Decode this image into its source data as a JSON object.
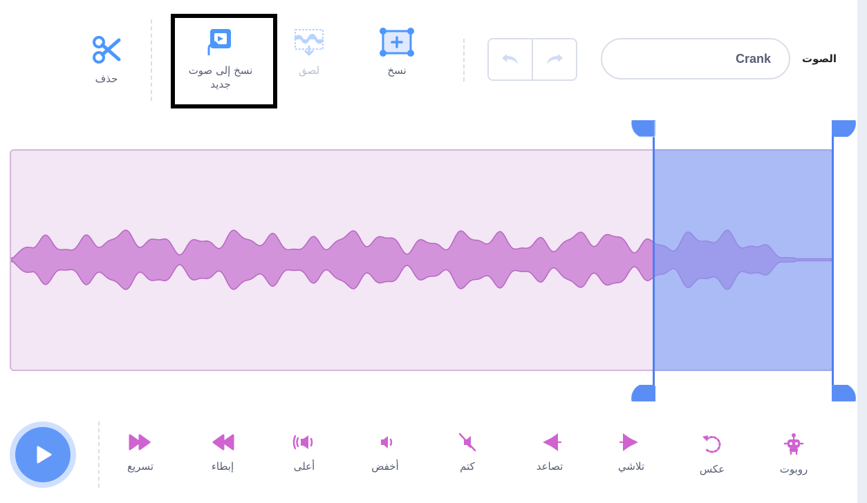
{
  "toolbar": {
    "sound_label": "الصوت",
    "sound_name": "Crank",
    "undo_icon": "undo-icon",
    "redo_icon": "redo-icon",
    "copy_label": "نسخ",
    "paste_label": "لصق",
    "copy_to_new_label_line1": "نسخ إلى صوت",
    "copy_to_new_label_line2": "جديد",
    "delete_label": "حذف"
  },
  "effects": [
    {
      "label": "روبوت",
      "icon": "robot-icon"
    },
    {
      "label": "عكس",
      "icon": "reverse-icon"
    },
    {
      "label": "تلاشي",
      "icon": "fade-out-icon"
    },
    {
      "label": "تصاعد",
      "icon": "fade-in-icon"
    },
    {
      "label": "كتم",
      "icon": "mute-icon"
    },
    {
      "label": "أخفض",
      "icon": "softer-icon"
    },
    {
      "label": "أعلى",
      "icon": "louder-icon"
    },
    {
      "label": "إبطاء",
      "icon": "slower-icon"
    },
    {
      "label": "تسريع",
      "icon": "faster-icon"
    }
  ],
  "colors": {
    "accent": "#4c97ff",
    "wave": "#cf8fdb",
    "effect_icon": "#cf63cf",
    "selection": "#7da0f5"
  }
}
